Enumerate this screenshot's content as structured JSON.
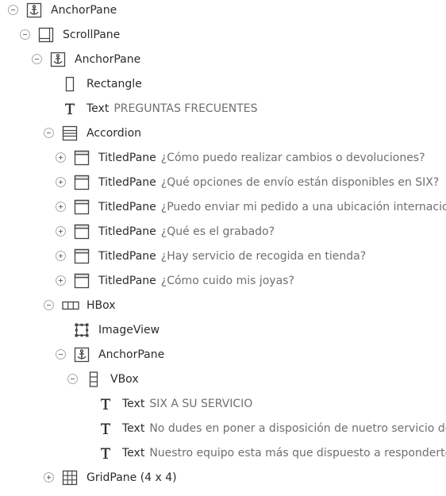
{
  "colors": {
    "type_text": "#2b2b2b",
    "value_text": "#6f6f6f",
    "icon": "#444444",
    "toggle_border": "#a9a9a9"
  },
  "tree": {
    "rows": [
      {
        "type": "AnchorPane",
        "value": "",
        "icon": "anchor-icon",
        "toggle": "collapse"
      },
      {
        "type": "ScrollPane",
        "value": "",
        "icon": "scrollpane-icon",
        "toggle": "collapse"
      },
      {
        "type": "AnchorPane",
        "value": "",
        "icon": "anchor-icon",
        "toggle": "collapse"
      },
      {
        "type": "Rectangle",
        "value": "",
        "icon": "rectangle-icon",
        "toggle": "none"
      },
      {
        "type": "Text",
        "value": "PREGUNTAS FRECUENTES",
        "icon": "text-icon",
        "toggle": "none"
      },
      {
        "type": "Accordion",
        "value": "",
        "icon": "accordion-icon",
        "toggle": "collapse"
      },
      {
        "type": "TitledPane",
        "value": "¿Cómo puedo realizar cambios o devoluciones?",
        "icon": "titledpane-icon",
        "toggle": "expand"
      },
      {
        "type": "TitledPane",
        "value": "¿Qué opciones de envío están disponibles en SIX?",
        "icon": "titledpane-icon",
        "toggle": "expand"
      },
      {
        "type": "TitledPane",
        "value": "¿Puedo enviar mi pedido a una ubicación internacional",
        "icon": "titledpane-icon",
        "toggle": "expand"
      },
      {
        "type": "TitledPane",
        "value": "¿Qué es el grabado?",
        "icon": "titledpane-icon",
        "toggle": "expand"
      },
      {
        "type": "TitledPane",
        "value": "¿Hay servicio de recogida en tienda?",
        "icon": "titledpane-icon",
        "toggle": "expand"
      },
      {
        "type": "TitledPane",
        "value": "¿Cómo cuido mis joyas?",
        "icon": "titledpane-icon",
        "toggle": "expand"
      },
      {
        "type": "HBox",
        "value": "",
        "icon": "hbox-icon",
        "toggle": "collapse"
      },
      {
        "type": "ImageView",
        "value": "",
        "icon": "imageview-icon",
        "toggle": "none"
      },
      {
        "type": "AnchorPane",
        "value": "",
        "icon": "anchor-icon",
        "toggle": "collapse"
      },
      {
        "type": "VBox",
        "value": "",
        "icon": "vbox-icon",
        "toggle": "collapse"
      },
      {
        "type": "Text",
        "value": "SIX A SU SERVICIO",
        "icon": "text-icon",
        "toggle": "none"
      },
      {
        "type": "Text",
        "value": "No dudes en poner a disposición de nuetro servicio de a",
        "icon": "text-icon",
        "toggle": "none"
      },
      {
        "type": "Text",
        "value": "Nuestro equipo esta más que dispuesto a responderte y",
        "icon": "text-icon",
        "toggle": "none"
      },
      {
        "type": "GridPane (4 x 4)",
        "value": "",
        "icon": "gridpane-icon",
        "toggle": "expand"
      }
    ]
  }
}
